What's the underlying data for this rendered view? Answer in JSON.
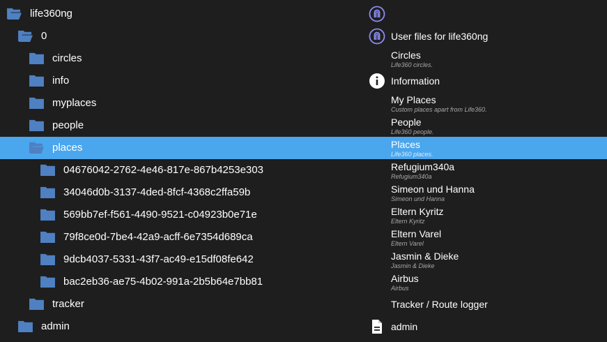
{
  "colors": {
    "background": "#1e1e1e",
    "selection": "#4aa6ed",
    "folder": "#4f80c2",
    "logo": "#8c8cf2",
    "text": "#ffffff",
    "description": "#a8a8a8"
  },
  "tree": [
    {
      "label": "life360ng",
      "open": true,
      "selected": false,
      "meta_icon": "life360-logo-icon",
      "meta_title": "",
      "meta_desc": ""
    },
    {
      "label": "0",
      "open": true,
      "selected": false,
      "meta_icon": "life360-logo-icon",
      "meta_title": "User files for life360ng",
      "meta_desc": ""
    },
    {
      "label": "circles",
      "open": false,
      "selected": false,
      "meta_icon": "",
      "meta_title": "Circles",
      "meta_desc": "Life360 circles."
    },
    {
      "label": "info",
      "open": false,
      "selected": false,
      "meta_icon": "info-icon",
      "meta_title": "Information",
      "meta_desc": ""
    },
    {
      "label": "myplaces",
      "open": false,
      "selected": false,
      "meta_icon": "",
      "meta_title": "My Places",
      "meta_desc": "Custom places apart from Life360."
    },
    {
      "label": "people",
      "open": false,
      "selected": false,
      "meta_icon": "",
      "meta_title": "People",
      "meta_desc": "Life360 people."
    },
    {
      "label": "places",
      "open": true,
      "selected": true,
      "meta_icon": "",
      "meta_title": "Places",
      "meta_desc": "Life360 places."
    },
    {
      "label": "04676042-2762-4e46-817e-867b4253e303",
      "open": false,
      "selected": false,
      "meta_icon": "",
      "meta_title": "Refugium340a",
      "meta_desc": "Refugium340a"
    },
    {
      "label": "34046d0b-3137-4ded-8fcf-4368c2ffa59b",
      "open": false,
      "selected": false,
      "meta_icon": "",
      "meta_title": "Simeon und Hanna",
      "meta_desc": "Simeon und Hanna"
    },
    {
      "label": "569bb7ef-f561-4490-9521-c04923b0e71e",
      "open": false,
      "selected": false,
      "meta_icon": "",
      "meta_title": "Eltern Kyritz",
      "meta_desc": "Eltern Kyritz"
    },
    {
      "label": "79f8ce0d-7be4-42a9-acff-6e7354d689ca",
      "open": false,
      "selected": false,
      "meta_icon": "",
      "meta_title": "Eltern Varel",
      "meta_desc": "Eltern Varel"
    },
    {
      "label": "9dcb4037-5331-43f7-ac49-e15df08fe642",
      "open": false,
      "selected": false,
      "meta_icon": "",
      "meta_title": "Jasmin & Dieke",
      "meta_desc": "Jasmin & Dieke"
    },
    {
      "label": "bac2eb36-ae75-4b02-991a-2b5b64e7bb81",
      "open": false,
      "selected": false,
      "meta_icon": "",
      "meta_title": "Airbus",
      "meta_desc": "Airbus"
    },
    {
      "label": "tracker",
      "open": false,
      "selected": false,
      "meta_icon": "",
      "meta_title": "Tracker / Route logger",
      "meta_desc": ""
    },
    {
      "label": "admin",
      "open": false,
      "selected": false,
      "meta_icon": "file-icon",
      "meta_title": "admin",
      "meta_desc": ""
    }
  ]
}
